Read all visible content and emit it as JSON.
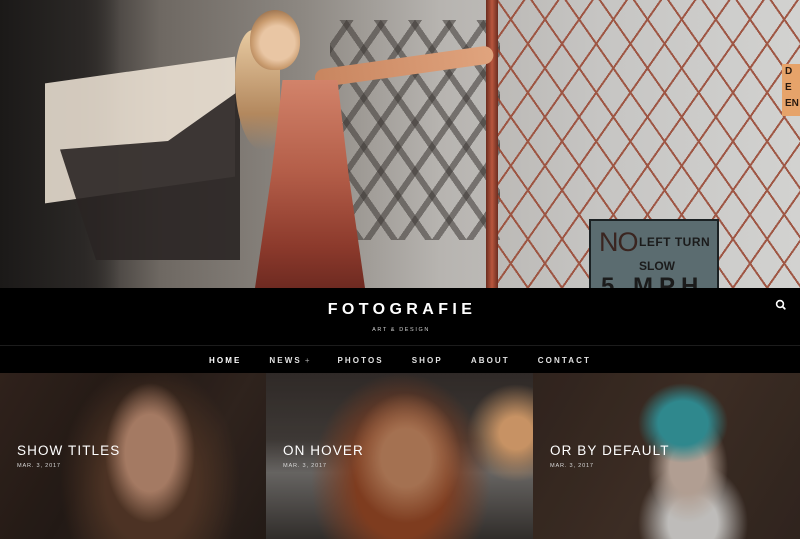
{
  "hero": {
    "sign": {
      "no": "NO",
      "left_turn": "LEFT TURN",
      "slow": "SLOW",
      "mph": "5 MPH"
    },
    "corner_sign": "D\nE\nEN"
  },
  "header": {
    "site_title": "FOTOGRAFIE",
    "tagline": "ART & DESIGN",
    "search_icon": "search-icon"
  },
  "nav": {
    "items": [
      {
        "label": "HOME",
        "active": true
      },
      {
        "label": "NEWS",
        "has_submenu": true,
        "submenu_marker": "+"
      },
      {
        "label": "PHOTOS"
      },
      {
        "label": "SHOP"
      },
      {
        "label": "ABOUT"
      },
      {
        "label": "CONTACT"
      }
    ]
  },
  "posts": [
    {
      "title": "SHOW TITLES",
      "date": "MAR. 3, 2017"
    },
    {
      "title": "ON HOVER",
      "date": "MAR. 3, 2017"
    },
    {
      "title": "OR BY DEFAULT",
      "date": "MAR. 3, 2017"
    }
  ],
  "colors": {
    "background": "#000000",
    "text": "#ffffff",
    "nav_text": "#e2e2e2"
  }
}
